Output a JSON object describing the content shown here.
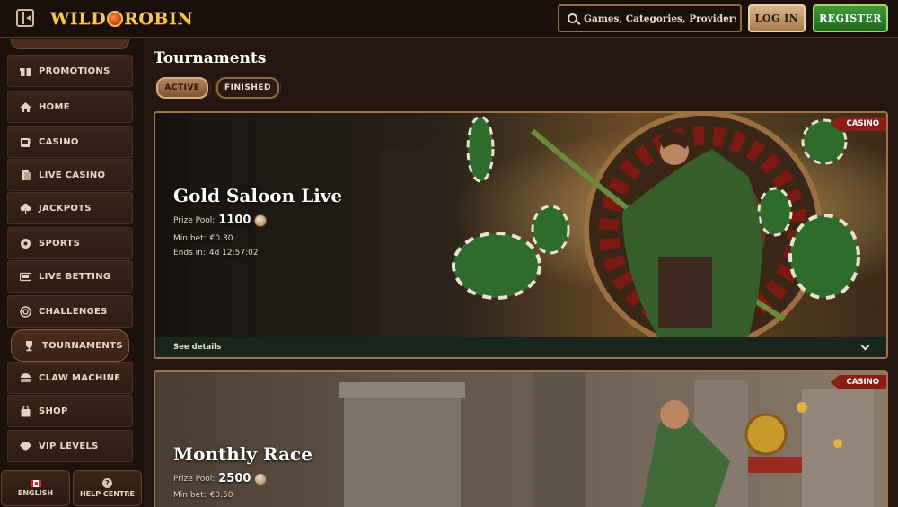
{
  "header": {
    "logo": {
      "part1": "WILD",
      "part2": "ROBIN"
    },
    "search_placeholder": "Games, Categories, Providers",
    "login_label": "LOG IN",
    "register_label": "REGISTER"
  },
  "sidebar": {
    "items": [
      {
        "label": "PROMOTIONS",
        "icon": "gift-icon"
      },
      {
        "label": "HOME",
        "icon": "home-icon"
      },
      {
        "label": "CASINO",
        "icon": "slot-machine-icon"
      },
      {
        "label": "LIVE CASINO",
        "icon": "cards-icon"
      },
      {
        "label": "JACKPOTS",
        "icon": "clover-icon"
      },
      {
        "label": "SPORTS",
        "icon": "ball-icon"
      },
      {
        "label": "LIVE BETTING",
        "icon": "live-icon"
      },
      {
        "label": "CHALLENGES",
        "icon": "target-icon"
      },
      {
        "label": "TOURNAMENTS",
        "icon": "trophy-icon"
      },
      {
        "label": "CLAW MACHINE",
        "icon": "claw-icon"
      },
      {
        "label": "SHOP",
        "icon": "bag-icon"
      },
      {
        "label": "VIP LEVELS",
        "icon": "diamond-icon"
      }
    ],
    "language_label": "ENGLISH",
    "help_label": "HELP CENTRE"
  },
  "main": {
    "title": "Tournaments",
    "tabs": [
      {
        "label": "ACTIVE"
      },
      {
        "label": "FINISHED"
      }
    ],
    "cards": [
      {
        "badge": "CASINO",
        "title": "Gold Saloon Live",
        "prize_label": "Prize Pool:",
        "prize_value": "1100",
        "min_bet_label": "Min bet:",
        "min_bet_value": "€0.30",
        "ends_label": "Ends in:",
        "ends_value": "4d 12:57:02",
        "details_label": "See details"
      },
      {
        "badge": "CASINO",
        "title": "Monthly Race",
        "prize_label": "Prize Pool:",
        "prize_value": "2500",
        "min_bet_label": "Min bet:",
        "min_bet_value": "€0.50"
      }
    ]
  },
  "colors": {
    "background": "#241510",
    "accent_gold": "#f7c64a",
    "register_green": "#2f8a2b",
    "badge_red": "#8a1e16"
  }
}
